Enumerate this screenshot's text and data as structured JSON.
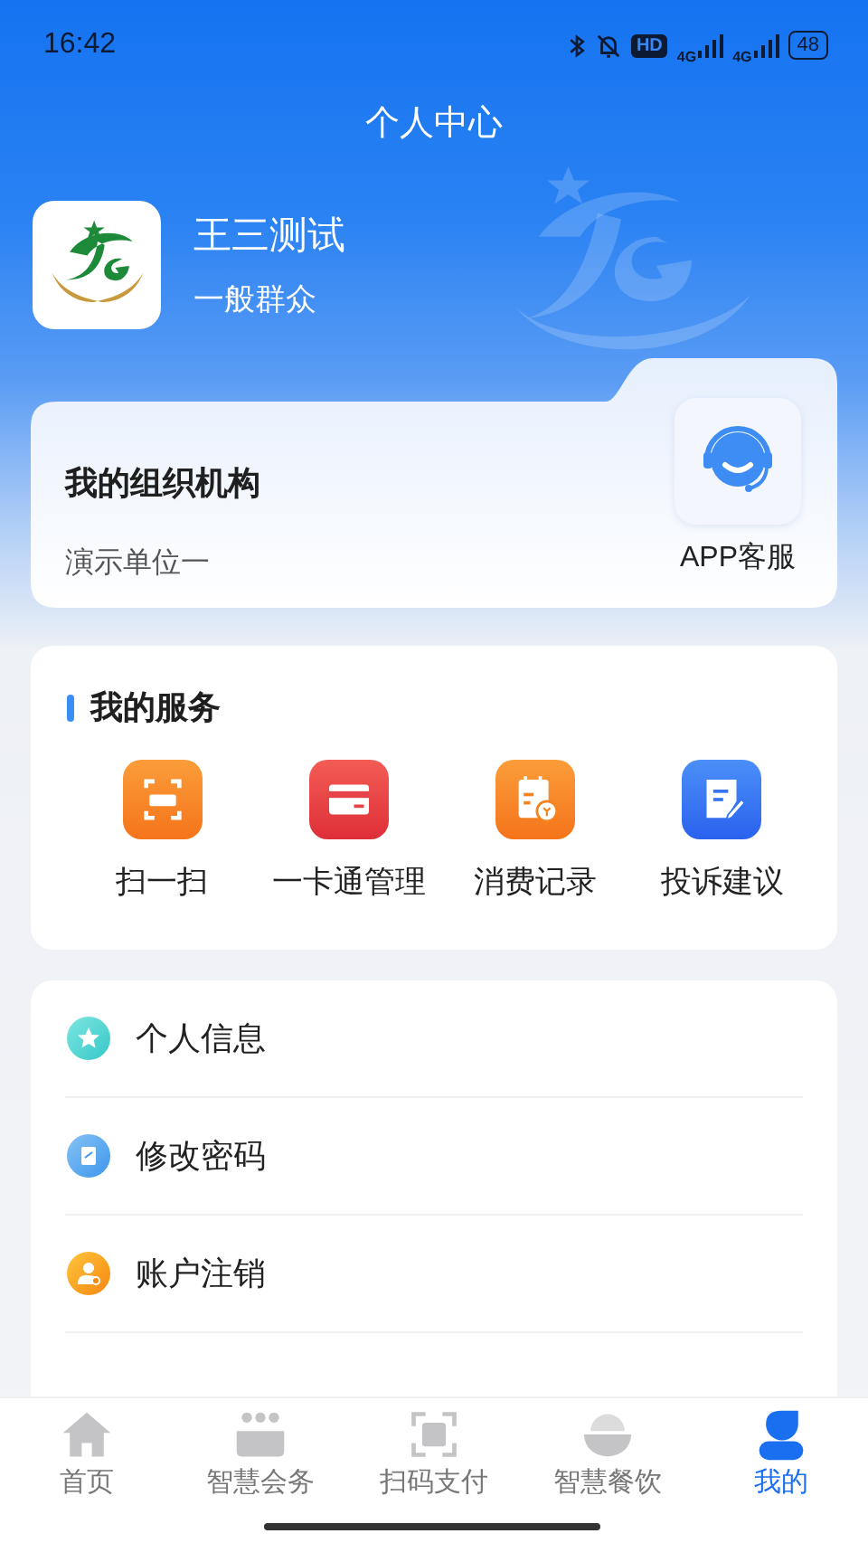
{
  "status_bar": {
    "time": "16:42",
    "hd": "HD",
    "network_1": "4G",
    "network_2": "4G",
    "battery": "48"
  },
  "title": "个人中心",
  "profile": {
    "name": "王三测试",
    "role": "一般群众"
  },
  "organization": {
    "heading": "我的组织机构",
    "unit": "演示单位一",
    "service_label": "APP客服"
  },
  "services": {
    "heading": "我的服务",
    "items": [
      {
        "label": "扫一扫"
      },
      {
        "label": "一卡通管理"
      },
      {
        "label": "消费记录"
      },
      {
        "label": "投诉建议"
      }
    ]
  },
  "menu": [
    {
      "label": "个人信息"
    },
    {
      "label": "修改密码"
    },
    {
      "label": "账户注销"
    }
  ],
  "tabs": [
    {
      "label": "首页",
      "selected": false
    },
    {
      "label": "智慧会务",
      "selected": false
    },
    {
      "label": "扫码支付",
      "selected": false
    },
    {
      "label": "智慧餐饮",
      "selected": false
    },
    {
      "label": "我的",
      "selected": true
    }
  ]
}
